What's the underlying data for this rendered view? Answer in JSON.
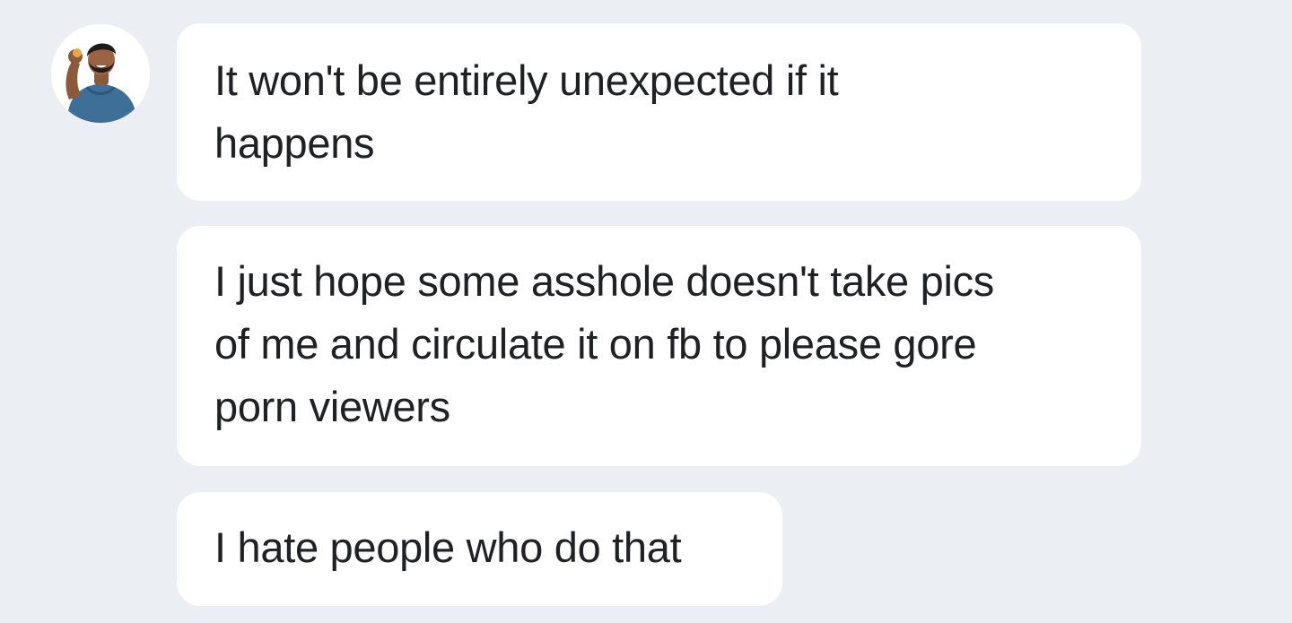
{
  "conversation": {
    "sender_avatar_icon": "profile-photo-avatar",
    "messages": [
      {
        "text": "It won't be entirely unexpected if it\nhappens"
      },
      {
        "text": "I just hope some asshole doesn't take pics\nof me and circulate it on fb to please gore\nporn viewers"
      },
      {
        "text": "I hate people who do that"
      }
    ]
  },
  "colors": {
    "background": "#ebeef2",
    "bubble": "#ffffff",
    "text": "#202124"
  }
}
